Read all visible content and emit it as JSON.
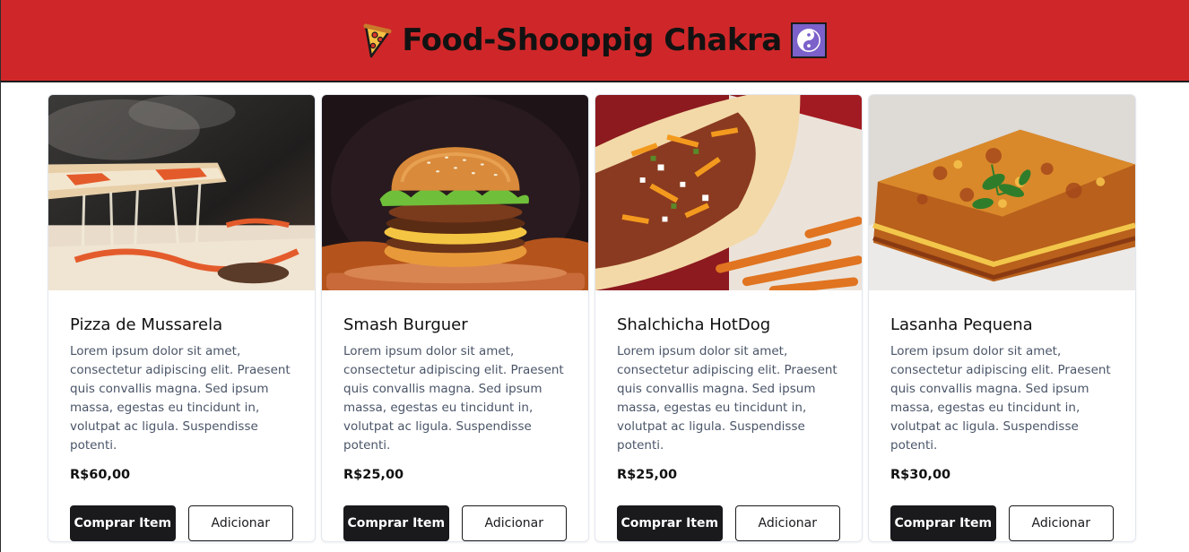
{
  "header": {
    "title": "Food-Shooppig Chakra",
    "left_icon": "pizza-icon",
    "right_icon": "yin-yang-icon",
    "background": "#cf2729",
    "accent": "#7b61c9"
  },
  "products": [
    {
      "name": "Pizza de Mussarela",
      "description": "Lorem ipsum dolor sit amet, consectetur adipiscing elit. Praesent quis convallis magna. Sed ipsum massa, egestas eu tincidunt in, volutpat ac ligula. Suspendisse potenti.",
      "price": "R$60,00",
      "buy_label": "Comprar Item",
      "add_label": "Adicionar"
    },
    {
      "name": "Smash Burguer",
      "description": "Lorem ipsum dolor sit amet, consectetur adipiscing elit. Praesent quis convallis magna. Sed ipsum massa, egestas eu tincidunt in, volutpat ac ligula. Suspendisse potenti.",
      "price": "R$25,00",
      "buy_label": "Comprar Item",
      "add_label": "Adicionar"
    },
    {
      "name": "Shalchicha HotDog",
      "description": "Lorem ipsum dolor sit amet, consectetur adipiscing elit. Praesent quis convallis magna. Sed ipsum massa, egestas eu tincidunt in, volutpat ac ligula. Suspendisse potenti.",
      "price": "R$25,00",
      "buy_label": "Comprar Item",
      "add_label": "Adicionar"
    },
    {
      "name": "Lasanha Pequena",
      "description": "Lorem ipsum dolor sit amet, consectetur adipiscing elit. Praesent quis convallis magna. Sed ipsum massa, egestas eu tincidunt in, volutpat ac ligula. Suspendisse potenti.",
      "price": "R$30,00",
      "buy_label": "Comprar Item",
      "add_label": "Adicionar"
    }
  ]
}
